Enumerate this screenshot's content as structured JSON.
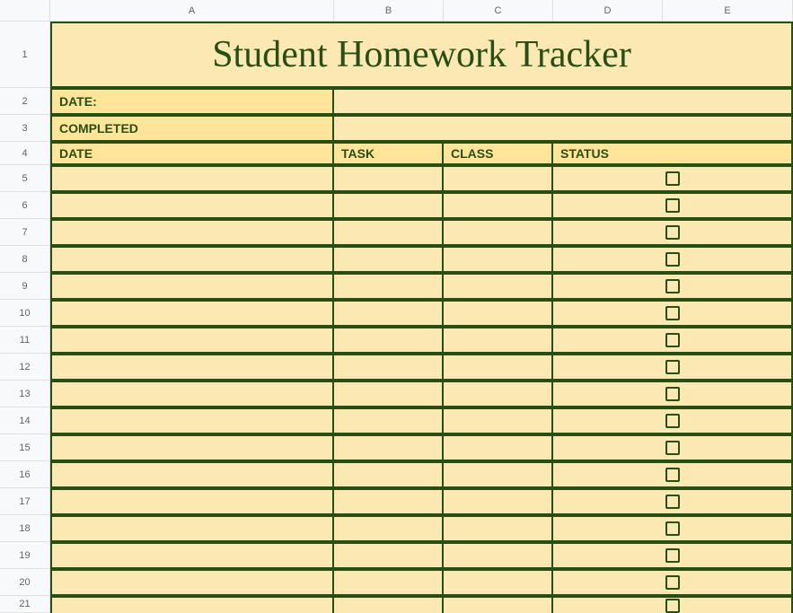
{
  "columns": [
    "A",
    "B",
    "C",
    "D",
    "E"
  ],
  "row_numbers": [
    1,
    2,
    3,
    4,
    5,
    6,
    7,
    8,
    9,
    10,
    11,
    12,
    13,
    14,
    15,
    16,
    17,
    18,
    19,
    20,
    21
  ],
  "title": "Student Homework Tracker",
  "labels": {
    "date": "DATE:",
    "completed": "COMPLETED"
  },
  "headers": {
    "date": "DATE",
    "task": "TASK",
    "class": "CLASS",
    "status": "STATUS"
  },
  "data_rows": [
    {
      "date": "",
      "task": "",
      "class": "",
      "status": false
    },
    {
      "date": "",
      "task": "",
      "class": "",
      "status": false
    },
    {
      "date": "",
      "task": "",
      "class": "",
      "status": false
    },
    {
      "date": "",
      "task": "",
      "class": "",
      "status": false
    },
    {
      "date": "",
      "task": "",
      "class": "",
      "status": false
    },
    {
      "date": "",
      "task": "",
      "class": "",
      "status": false
    },
    {
      "date": "",
      "task": "",
      "class": "",
      "status": false
    },
    {
      "date": "",
      "task": "",
      "class": "",
      "status": false
    },
    {
      "date": "",
      "task": "",
      "class": "",
      "status": false
    },
    {
      "date": "",
      "task": "",
      "class": "",
      "status": false
    },
    {
      "date": "",
      "task": "",
      "class": "",
      "status": false
    },
    {
      "date": "",
      "task": "",
      "class": "",
      "status": false
    },
    {
      "date": "",
      "task": "",
      "class": "",
      "status": false
    },
    {
      "date": "",
      "task": "",
      "class": "",
      "status": false
    },
    {
      "date": "",
      "task": "",
      "class": "",
      "status": false
    },
    {
      "date": "",
      "task": "",
      "class": "",
      "status": false
    },
    {
      "date": "",
      "task": "",
      "class": "",
      "status": false
    }
  ]
}
